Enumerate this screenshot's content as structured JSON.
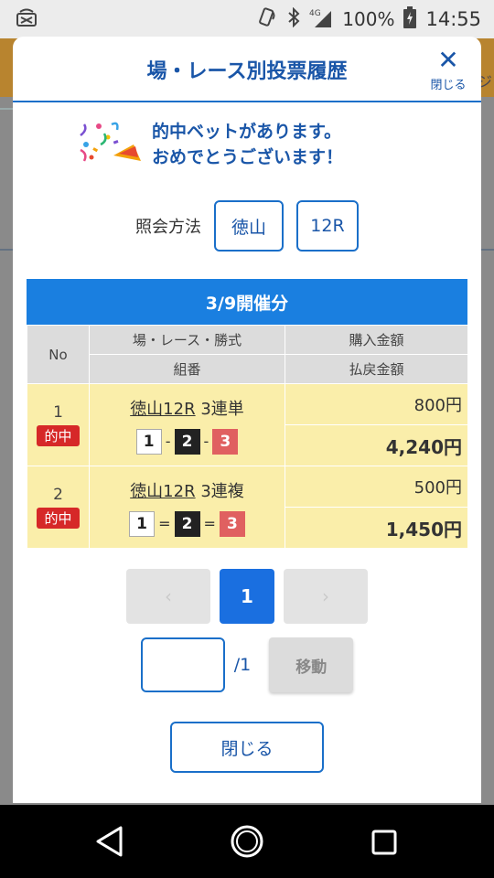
{
  "status": {
    "network": "4G",
    "battery": "100%",
    "time": "14:55"
  },
  "background": {
    "edge_text": "ジ"
  },
  "dialog": {
    "title": "場・レース別投票履歴",
    "close_icon_label": "閉じる",
    "hit_message": {
      "line1": "的中ベットがあります。",
      "line2": "おめでとうございます！"
    },
    "query": {
      "label": "照会方法",
      "venue": "徳山",
      "race": "12R"
    },
    "date_header": "3/9開催分",
    "table": {
      "headers": {
        "no": "No",
        "race_type": "場・レース・勝式",
        "combination": "組番",
        "purchase": "購入金額",
        "payout": "払戻金額"
      },
      "rows": [
        {
          "no": "1",
          "badge": "的中",
          "venue_race": "徳山12R",
          "bet_type": "3連単",
          "combo": [
            "1",
            "2",
            "3"
          ],
          "sep": "-",
          "purchase": "800円",
          "payout": "4,240円"
        },
        {
          "no": "2",
          "badge": "的中",
          "venue_race": "徳山12R",
          "bet_type": "3連複",
          "combo": [
            "1",
            "2",
            "3"
          ],
          "sep": "=",
          "purchase": "500円",
          "payout": "1,450円"
        }
      ]
    },
    "pager": {
      "prev": "‹",
      "current": "1",
      "next": "›"
    },
    "jump": {
      "input_value": "",
      "total": "/1",
      "button": "移動"
    },
    "close_button": "閉じる"
  },
  "colors": {
    "accent": "#1a6fc9",
    "header_bar": "#1a7fe0",
    "hit_badge": "#d62828",
    "row_bg": "#faeeaa"
  }
}
